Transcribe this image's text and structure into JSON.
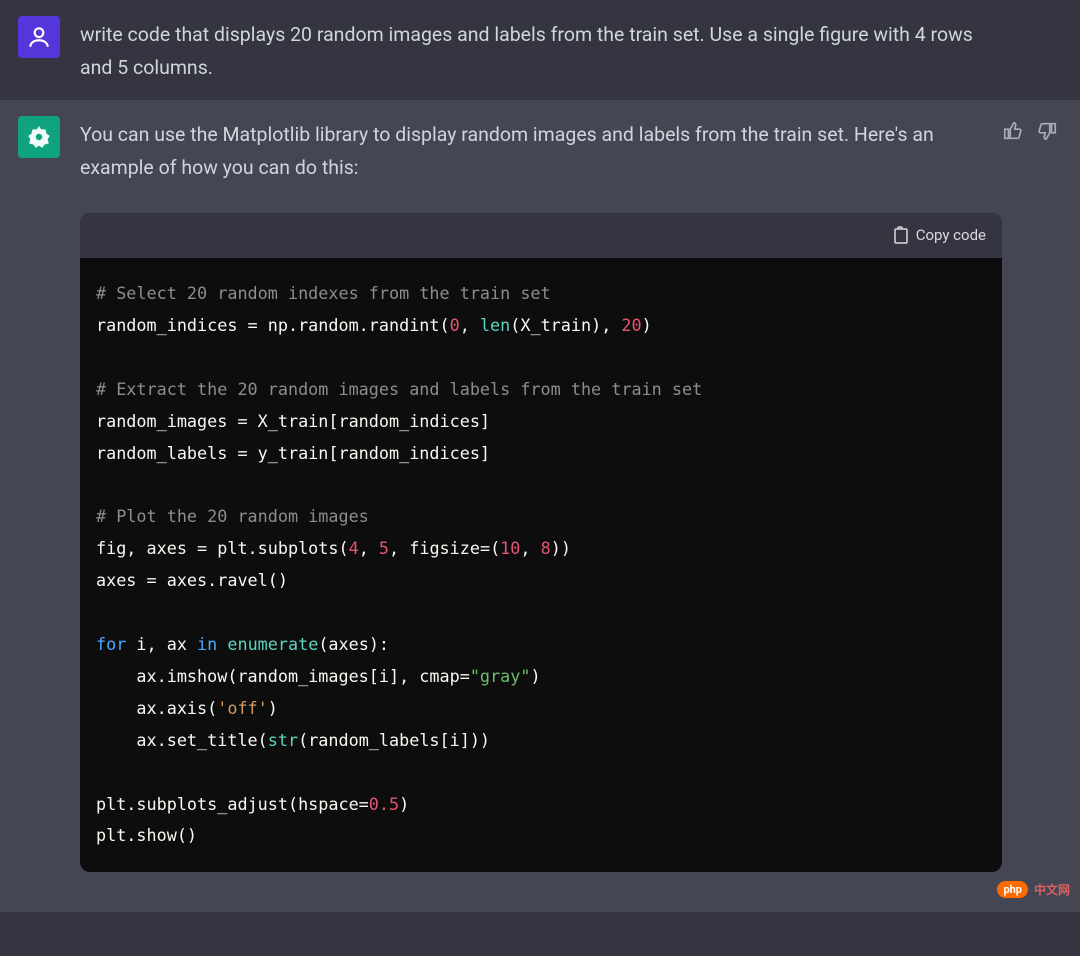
{
  "user_message": "write code that displays 20 random images and labels from the train set. Use a single figure with 4 rows and 5 columns.",
  "assistant_intro": "You can use the Matplotlib library to display random images and labels from the train set. Here's an example of how you can do this:",
  "copy_label": "Copy code",
  "code": {
    "c1": "# Select 20 random indexes from the train set",
    "l2a": "random_indices = np.random.randint(",
    "l2n0": "0",
    "l2b": ", ",
    "l2len": "len",
    "l2c": "(X_train), ",
    "l2n20": "20",
    "l2d": ")",
    "c2": "# Extract the 20 random images and labels from the train set",
    "l4": "random_images = X_train[random_indices]",
    "l5": "random_labels = y_train[random_indices]",
    "c3": "# Plot the 20 random images",
    "l7a": "fig, axes = plt.subplots(",
    "l7n4": "4",
    "l7c1": ", ",
    "l7n5": "5",
    "l7c2": ", figsize=(",
    "l7n10": "10",
    "l7c3": ", ",
    "l7n8": "8",
    "l7c4": "))",
    "l8": "axes = axes.ravel()",
    "l9for": "for",
    "l9a": " i, ax ",
    "l9in": "in",
    "l9b": " ",
    "l9enum": "enumerate",
    "l9c": "(axes):",
    "l10a": "    ax.imshow(random_images[i], cmap=",
    "l10s": "\"gray\"",
    "l10b": ")",
    "l11a": "    ax.axis(",
    "l11s": "'off'",
    "l11b": ")",
    "l12a": "    ax.set_title(",
    "l12str": "str",
    "l12b": "(random_labels[i]))",
    "l13a": "plt.subplots_adjust(hspace=",
    "l13n": "0.5",
    "l13b": ")",
    "l14": "plt.show()"
  },
  "watermark_logo": "php",
  "watermark_text": "中文网"
}
